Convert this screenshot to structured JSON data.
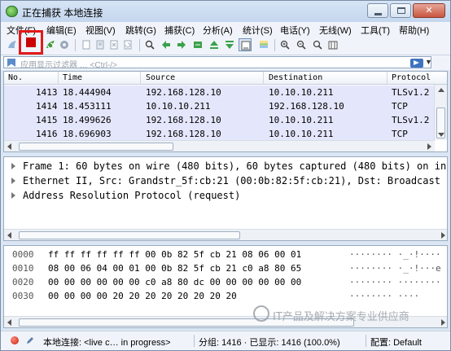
{
  "window": {
    "title": "正在捕获 本地连接",
    "buttons": {
      "minimize": "",
      "maximize": "",
      "close": "✕"
    }
  },
  "menu": [
    "文件(F)",
    "编辑(E)",
    "视图(V)",
    "跳转(G)",
    "捕获(C)",
    "分析(A)",
    "统计(S)",
    "电话(Y)",
    "无线(W)",
    "工具(T)",
    "帮助(H)"
  ],
  "toolbar_icons": [
    "fin-icon",
    "stop-capture-icon",
    "restart-capture-icon",
    "capture-options-icon",
    "open-file-icon",
    "save-file-icon",
    "close-file-icon",
    "reload-file-icon",
    "find-packet-icon",
    "go-back-icon",
    "go-forward-icon",
    "go-to-packet-icon",
    "go-first-icon",
    "go-last-icon",
    "auto-scroll-icon",
    "colorize-icon",
    "zoom-in-icon",
    "zoom-out-icon",
    "zoom-normal-icon",
    "resize-columns-icon"
  ],
  "filter": {
    "placeholder": "应用显示过滤器 … <Ctrl-/>",
    "dropdown": "▼"
  },
  "packet_list": {
    "columns": [
      "No.",
      "Time",
      "Source",
      "Destination",
      "Protocol"
    ],
    "rows": [
      {
        "no": "1413",
        "time": "18.444904",
        "source": "192.168.128.10",
        "destination": "10.10.10.211",
        "protocol": "TLSv1.2"
      },
      {
        "no": "1414",
        "time": "18.453111",
        "source": "10.10.10.211",
        "destination": "192.168.128.10",
        "protocol": "TCP"
      },
      {
        "no": "1415",
        "time": "18.499626",
        "source": "192.168.128.10",
        "destination": "10.10.10.211",
        "protocol": "TLSv1.2"
      },
      {
        "no": "1416",
        "time": "18.696903",
        "source": "192.168.128.10",
        "destination": "10.10.10.211",
        "protocol": "TCP"
      }
    ]
  },
  "details": [
    "Frame 1: 60 bytes on wire (480 bits), 60 bytes captured (480 bits) on in",
    "Ethernet II, Src: Grandstr_5f:cb:21 (00:0b:82:5f:cb:21), Dst: Broadcast",
    "Address Resolution Protocol (request)"
  ],
  "bytes": [
    {
      "offset": "0000",
      "hex": "ff ff ff ff ff ff 00 0b  82 5f cb 21 08 06 00 01",
      "ascii": "········ ·_·!····"
    },
    {
      "offset": "0010",
      "hex": "08 00 06 04 00 01 00 0b  82 5f cb 21 c0 a8 80 65",
      "ascii": "········ ·_·!···e"
    },
    {
      "offset": "0020",
      "hex": "00 00 00 00 00 00 c0 a8  80 dc 00 00 00 00 00 00",
      "ascii": "········ ········"
    },
    {
      "offset": "0030",
      "hex": "00 00 00 00 20 20 20 20  20 20 20 20",
      "ascii": "········ ····"
    }
  ],
  "status": {
    "interface": "本地连接: <live c… in progress>",
    "packets": "分组: 1416 · 已显示: 1416 (100.0%)",
    "profile": "配置: Default"
  },
  "watermark": "IT产品及解决方案专业供应商",
  "colors": {
    "row_bg": "#e4e6fb",
    "stop_red": "#cc0000",
    "highlight_red": "#e21a1a"
  }
}
